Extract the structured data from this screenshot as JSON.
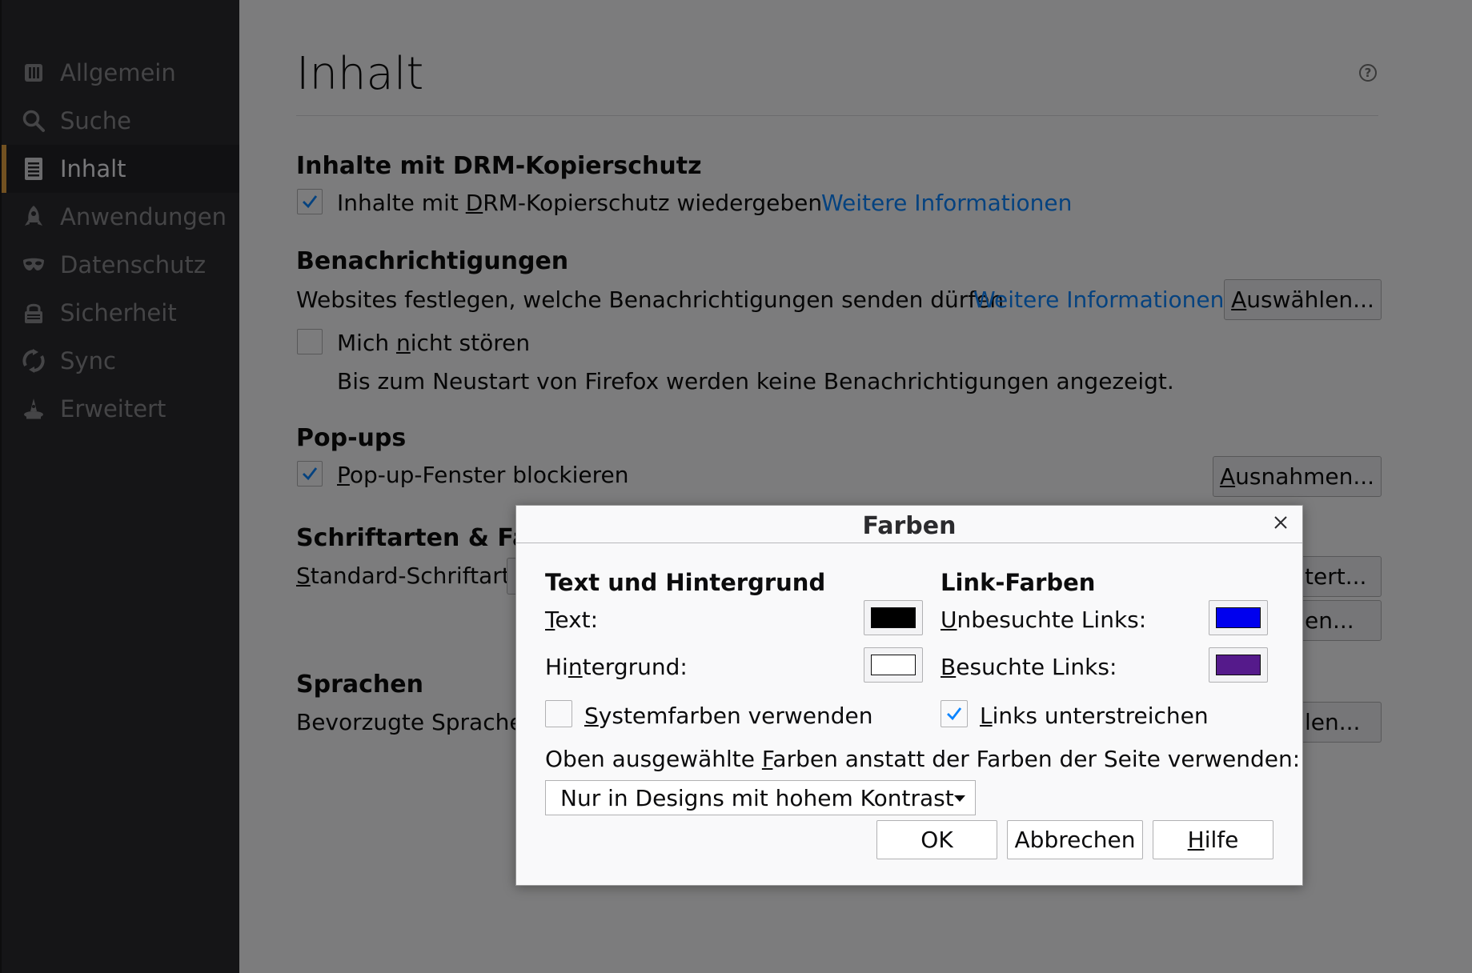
{
  "sidebar": {
    "items": [
      {
        "label": "Allgemein",
        "icon": "general-icon"
      },
      {
        "label": "Suche",
        "icon": "search-icon"
      },
      {
        "label": "Inhalt",
        "icon": "content-icon",
        "selected": true
      },
      {
        "label": "Anwendungen",
        "icon": "applications-icon"
      },
      {
        "label": "Datenschutz",
        "icon": "privacy-mask-icon"
      },
      {
        "label": "Sicherheit",
        "icon": "security-lock-icon"
      },
      {
        "label": "Sync",
        "icon": "sync-icon"
      },
      {
        "label": "Erweitert",
        "icon": "advanced-wizard-icon"
      }
    ]
  },
  "main": {
    "title": "Inhalt",
    "drm": {
      "heading": "Inhalte mit DRM-Kopierschutz",
      "checkbox_pre": "Inhalte mit ",
      "checkbox_accel": "D",
      "checkbox_post": "RM-Kopierschutz wiedergeben",
      "checked": true,
      "link": "Weitere Informationen"
    },
    "notifications": {
      "heading": "Benachrichtigungen",
      "description": "Websites festlegen, welche Benachrichtigungen senden dürfen",
      "link": "Weitere Informationen",
      "button_accel": "A",
      "button_rest": "uswählen...",
      "dnd_pre": "Mich ",
      "dnd_accel": "n",
      "dnd_post": "icht stören",
      "dnd_checked": false,
      "dnd_note": "Bis zum Neustart von Firefox werden keine Benachrichtigungen angezeigt."
    },
    "popups": {
      "heading": "Pop-ups",
      "checkbox_accel": "P",
      "checkbox_rest": "op-up-Fenster blockieren",
      "checked": true,
      "button_accel": "A",
      "button_rest": "usnahmen..."
    },
    "fonts": {
      "heading_visible": "Schriftarten & Farb",
      "default_font_accel": "S",
      "default_font_rest": "tandard-Schriftart:",
      "button1_visible": "tert...",
      "button2_visible": "en..."
    },
    "languages": {
      "heading": "Sprachen",
      "description_visible": "Bevorzugte Sprachen",
      "button_visible": "len..."
    }
  },
  "dialog": {
    "title": "Farben",
    "text_bg": {
      "heading": "Text und Hintergrund",
      "text_accel": "T",
      "text_rest": "ext:",
      "text_color": "#000000",
      "bg_pre": "Hi",
      "bg_accel": "n",
      "bg_post": "tergrund:",
      "bg_color": "#ffffff",
      "system_accel": "S",
      "system_rest": "ystemfarben verwenden",
      "system_checked": false
    },
    "links": {
      "heading": "Link-Farben",
      "unvisited_accel": "U",
      "unvisited_rest": "nbesuchte Links:",
      "unvisited_color": "#0000ee",
      "visited_accel": "B",
      "visited_rest": "esuchte Links:",
      "visited_color": "#551a8b",
      "underline_accel": "L",
      "underline_rest": "inks unterstreichen",
      "underline_checked": true
    },
    "override_pre": "Oben ausgewählte ",
    "override_accel": "F",
    "override_post": "arben anstatt der Farben der Seite verwenden:",
    "select_value": "Nur in Designs mit hohem Kontrast",
    "ok": "OK",
    "cancel": "Abbrechen",
    "help_accel": "H",
    "help_rest": "ilfe"
  },
  "colors": {
    "accent": "#e4a243",
    "link": "#0a84ff",
    "checkmark": "#0a84ff"
  }
}
